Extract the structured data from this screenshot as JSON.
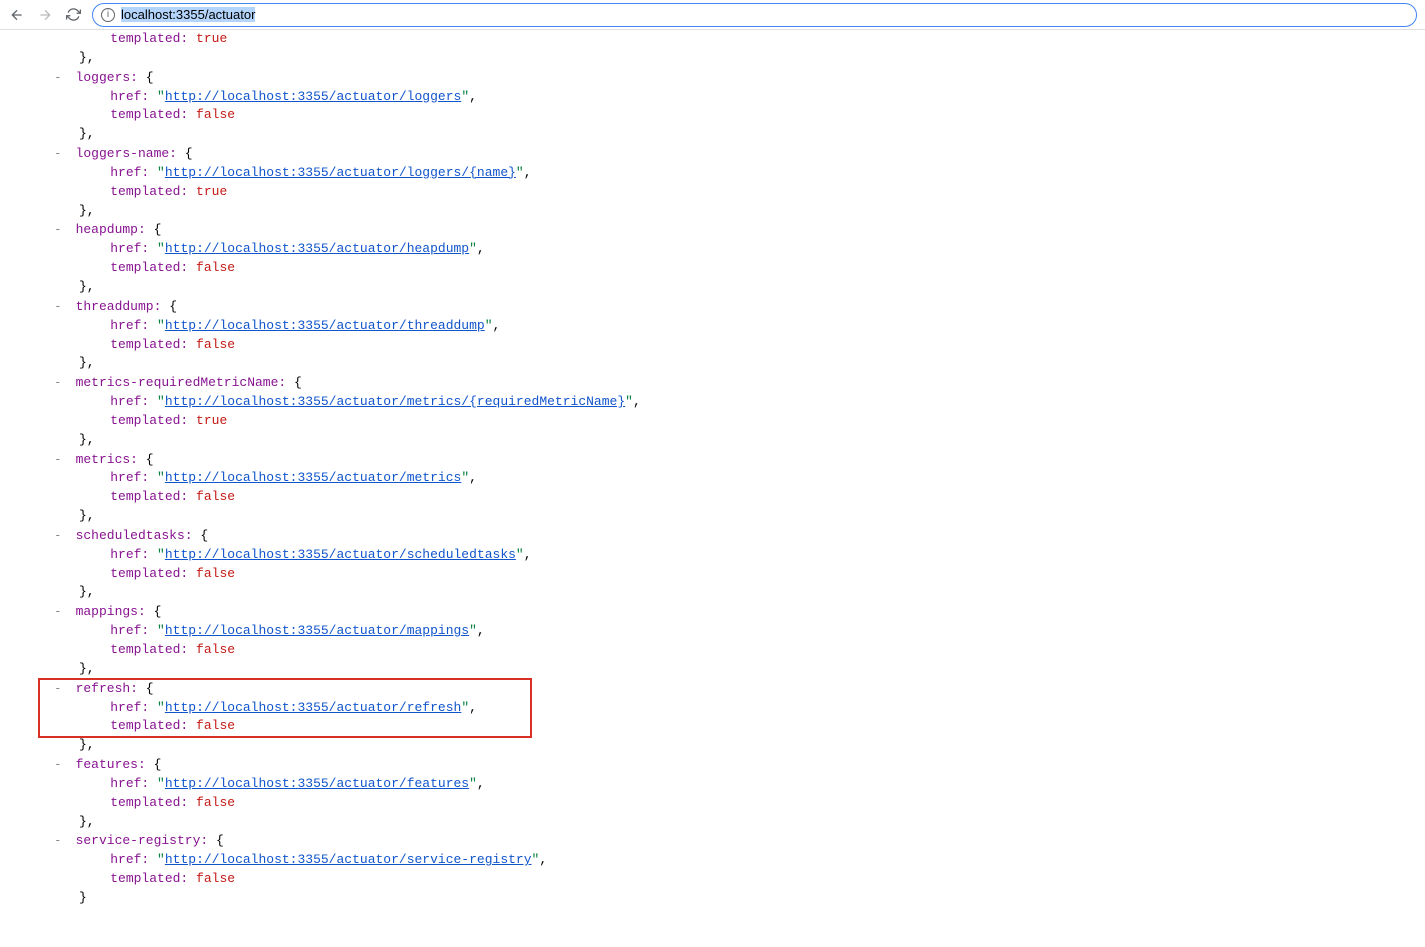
{
  "browser": {
    "url": "localhost:3355/actuator"
  },
  "json": {
    "templated_label": "templated",
    "href_label": "href",
    "open_brace": "{",
    "close_brace": "}",
    "collapse": "-",
    "bool_true": "true",
    "bool_false": "false",
    "entries": [
      {
        "partial_top": true,
        "templated": "true"
      },
      {
        "key": "loggers",
        "href": "http://localhost:3355/actuator/loggers",
        "templated": "false"
      },
      {
        "key": "loggers-name",
        "href": "http://localhost:3355/actuator/loggers/{name}",
        "templated": "true"
      },
      {
        "key": "heapdump",
        "href": "http://localhost:3355/actuator/heapdump",
        "templated": "false"
      },
      {
        "key": "threaddump",
        "href": "http://localhost:3355/actuator/threaddump",
        "templated": "false"
      },
      {
        "key": "metrics-requiredMetricName",
        "href": "http://localhost:3355/actuator/metrics/{requiredMetricName}",
        "templated": "true"
      },
      {
        "key": "metrics",
        "href": "http://localhost:3355/actuator/metrics",
        "templated": "false"
      },
      {
        "key": "scheduledtasks",
        "href": "http://localhost:3355/actuator/scheduledtasks",
        "templated": "false"
      },
      {
        "key": "mappings",
        "href": "http://localhost:3355/actuator/mappings",
        "templated": "false"
      },
      {
        "key": "refresh",
        "href": "http://localhost:3355/actuator/refresh",
        "templated": "false",
        "highlighted": true
      },
      {
        "key": "features",
        "href": "http://localhost:3355/actuator/features",
        "templated": "false"
      },
      {
        "key": "service-registry",
        "href": "http://localhost:3355/actuator/service-registry",
        "templated": "false",
        "last": true
      }
    ]
  }
}
